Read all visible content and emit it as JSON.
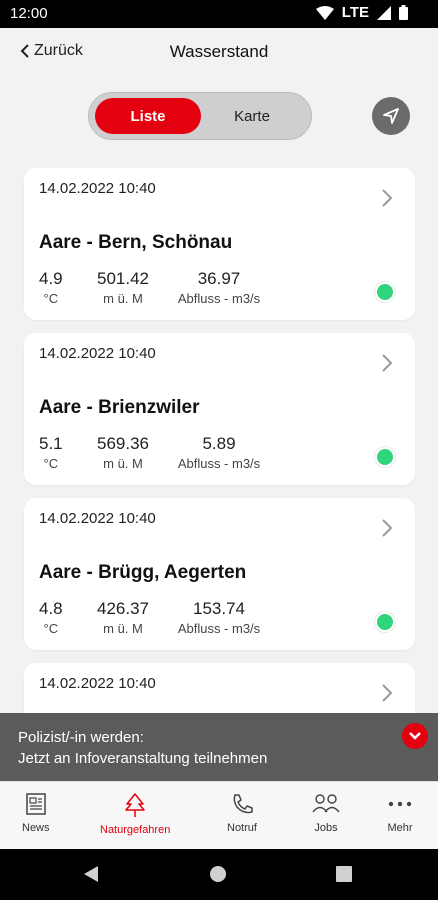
{
  "status": {
    "time": "12:00",
    "network": "LTE"
  },
  "header": {
    "back_label": "Zurück",
    "title": "Wasserstand"
  },
  "view_toggle": {
    "active": "Liste",
    "inactive": "Karte"
  },
  "stations": [
    {
      "timestamp": "14.02.2022 10:40",
      "name": "Aare - Bern, Schönau",
      "temp": "4.9",
      "temp_unit": "°C",
      "level": "501.42",
      "level_unit": "m ü. M",
      "flow": "36.97",
      "flow_unit": "Abfluss - m3/s",
      "status_color": "#2fd47b"
    },
    {
      "timestamp": "14.02.2022 10:40",
      "name": "Aare - Brienzwiler",
      "temp": "5.1",
      "temp_unit": "°C",
      "level": "569.36",
      "level_unit": "m ü. M",
      "flow": "5.89",
      "flow_unit": "Abfluss - m3/s",
      "status_color": "#2fd47b"
    },
    {
      "timestamp": "14.02.2022 10:40",
      "name": "Aare - Brügg, Aegerten",
      "temp": "4.8",
      "temp_unit": "°C",
      "level": "426.37",
      "level_unit": "m ü. M",
      "flow": "153.74",
      "flow_unit": "Abfluss - m3/s",
      "status_color": "#2fd47b"
    },
    {
      "timestamp": "14.02.2022 10:40"
    }
  ],
  "banner": {
    "line1": "Polizist/-in werden:",
    "line2": "Jetzt an Infoveranstaltung teilnehmen"
  },
  "tabs": [
    {
      "label": "News",
      "icon": "newspaper-icon"
    },
    {
      "label": "Naturgefahren",
      "icon": "tree-icon"
    },
    {
      "label": "Notruf",
      "icon": "phone-icon"
    },
    {
      "label": "Jobs",
      "icon": "people-icon"
    },
    {
      "label": "Mehr",
      "icon": "more-icon"
    }
  ],
  "colors": {
    "accent": "#e3000f",
    "status_ok": "#2fd47b",
    "banner_bg": "#5b5b5b"
  }
}
